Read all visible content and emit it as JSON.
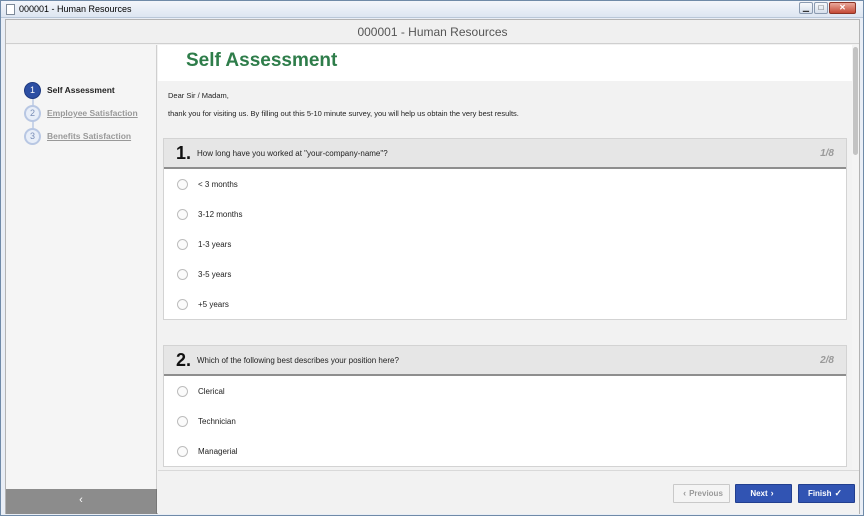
{
  "window": {
    "title": "000001 - Human Resources",
    "min_label": "▁",
    "max_label": "□",
    "close_label": "✕"
  },
  "app": {
    "header_title": "000001 - Human Resources"
  },
  "sidebar": {
    "steps": [
      {
        "num": "1",
        "label": "Self Assessment"
      },
      {
        "num": "2",
        "label": "Employee Satisfaction"
      },
      {
        "num": "3",
        "label": "Benefits Satisfaction"
      }
    ],
    "collapse_label": "‹"
  },
  "main": {
    "title": "Self Assessment",
    "greeting": "Dear Sir / Madam,",
    "intro": "thank you for visiting us. By filling out this 5-10 minute survey, you will help us obtain the very best results.",
    "questions": [
      {
        "num": "1.",
        "text": "How long have you worked at \"your-company-name\"?",
        "count": "1/8",
        "options": [
          "< 3 months",
          "3-12 months",
          "1-3 years",
          "3-5 years",
          "+5 years"
        ]
      },
      {
        "num": "2.",
        "text": "Which of the following best describes your position here?",
        "count": "2/8",
        "options": [
          "Clerical",
          "Technician",
          "Managerial"
        ]
      }
    ]
  },
  "footer": {
    "previous_label": "Previous",
    "previous_icon": "‹",
    "next_label": "Next",
    "next_icon": "›",
    "finish_label": "Finish",
    "finish_icon": "✓"
  },
  "colors": {
    "accent": "#3154b3",
    "title_green": "#2e7d4a",
    "step_active": "#2d4fa3"
  }
}
